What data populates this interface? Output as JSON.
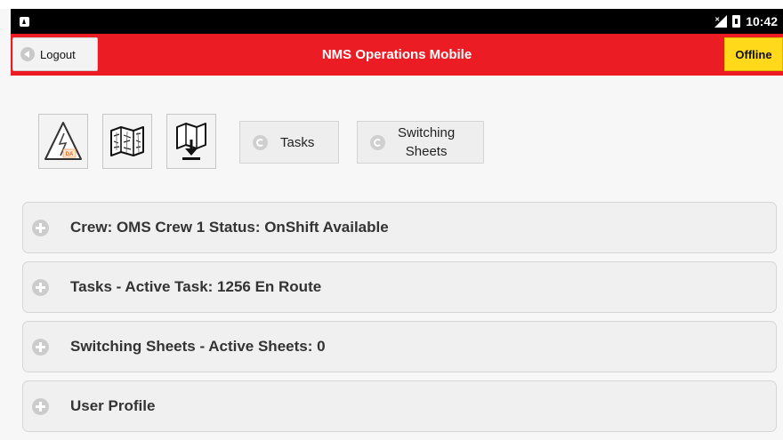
{
  "status_bar": {
    "time": "10:42",
    "icons": [
      "notification-icon",
      "no-signal-icon",
      "battery-icon"
    ]
  },
  "header": {
    "title": "NMS Operations Mobile",
    "logout_label": "Logout",
    "offline_label": "Offline",
    "bar_color": "#ec1c24",
    "offline_color": "#ffd91a"
  },
  "toolbar": {
    "icon_buttons": [
      {
        "icon": "damage-assessment-icon",
        "badge": "DA"
      },
      {
        "icon": "map-icon"
      },
      {
        "icon": "map-download-icon"
      }
    ],
    "tasks_label": "Tasks",
    "switching_sheets_label_line1": "Switching",
    "switching_sheets_label_line2": "Sheets"
  },
  "sections": [
    {
      "label": "Crew: OMS Crew 1 Status: OnShift Available"
    },
    {
      "label": "Tasks - Active Task: 1256 En Route"
    },
    {
      "label": "Switching Sheets - Active Sheets: 0"
    },
    {
      "label": "User Profile"
    }
  ]
}
